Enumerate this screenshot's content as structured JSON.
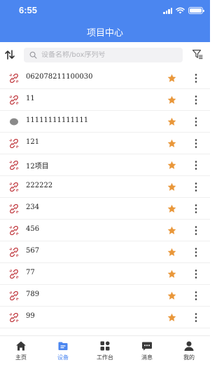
{
  "status_bar": {
    "time": "6:55"
  },
  "header": {
    "title": "项目中心",
    "background": "#4b86f0"
  },
  "toolbar": {
    "sort_icon": "sort-arrows-icon",
    "search_placeholder": "设备名称/box序列号",
    "search_value": "",
    "filter_icon": "filter-icon"
  },
  "devices": [
    {
      "name": "062078211100030",
      "status": "offline",
      "starred": true
    },
    {
      "name": "11",
      "status": "offline",
      "starred": true
    },
    {
      "name": "11111111111111",
      "status": "unknown",
      "starred": true
    },
    {
      "name": "121",
      "status": "offline",
      "starred": true
    },
    {
      "name": "12项目",
      "status": "offline",
      "starred": true
    },
    {
      "name": "222222",
      "status": "offline",
      "starred": true
    },
    {
      "name": "234",
      "status": "offline",
      "starred": true
    },
    {
      "name": "456",
      "status": "offline",
      "starred": true
    },
    {
      "name": "567",
      "status": "offline",
      "starred": true
    },
    {
      "name": "77",
      "status": "offline",
      "starred": true
    },
    {
      "name": "789",
      "status": "offline",
      "starred": true
    },
    {
      "name": "99",
      "status": "offline",
      "starred": true
    }
  ],
  "colors": {
    "accent": "#4b86f0",
    "star": "#e9973a",
    "offline_link": "#c0393f",
    "unknown": "#8a8a8a"
  },
  "tabbar": {
    "items": [
      {
        "label": "主页",
        "icon": "home-icon",
        "active": false
      },
      {
        "label": "设备",
        "icon": "device-folder-icon",
        "active": true
      },
      {
        "label": "工作台",
        "icon": "workbench-grid-icon",
        "active": false
      },
      {
        "label": "消息",
        "icon": "message-icon",
        "active": false
      },
      {
        "label": "我的",
        "icon": "person-icon",
        "active": false
      }
    ]
  }
}
